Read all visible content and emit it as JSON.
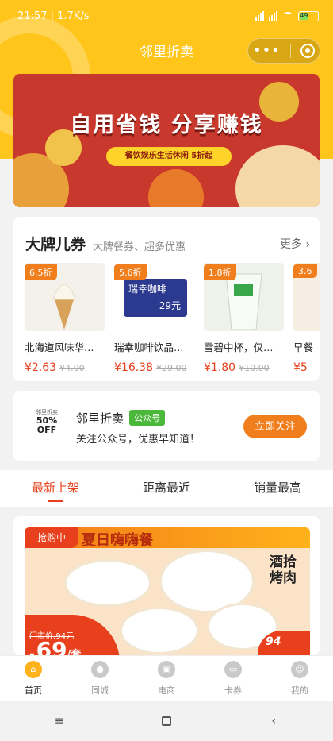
{
  "status_bar": {
    "time": "21:57",
    "speed": "1.7K/s",
    "battery": "49"
  },
  "header": {
    "title": "邻里折卖",
    "capsule_more_icon": "more-dots-icon",
    "capsule_close_icon": "target-circle-icon"
  },
  "banner": {
    "headline": "自用省钱 分享赚钱",
    "pill": "餐饮娱乐生活休闲  5折起"
  },
  "coupons": {
    "title": "大牌儿券",
    "subtitle": "大牌餐券、超多优惠",
    "more": "更多",
    "items": [
      {
        "discount": "6.5折",
        "name": "北海道风味华…",
        "price": "¥2.63",
        "orig": "¥4.00"
      },
      {
        "discount": "5.6折",
        "name": "瑞幸咖啡饮品…",
        "price": "¥16.38",
        "orig": "¥29.00",
        "brand_text": "瑞幸咖啡",
        "brand_value": "29元"
      },
      {
        "discount": "1.8折",
        "name": "雪碧中杯，仅…",
        "price": "¥1.80",
        "orig": "¥10.00"
      },
      {
        "discount": "3.6",
        "name": "早餐",
        "price": "¥5",
        "orig": ""
      }
    ]
  },
  "follow": {
    "logo_top": "邻里折卖",
    "logo_mid": "50%",
    "logo_bot": "OFF",
    "name": "邻里折卖",
    "tag": "公众号",
    "desc": "关注公众号，优惠早知道！",
    "button": "立即关注"
  },
  "tabs": [
    {
      "label": "最新上架",
      "active": true
    },
    {
      "label": "距离最近",
      "active": false
    },
    {
      "label": "销量最高",
      "active": false
    }
  ],
  "deal": {
    "tag": "抢购中",
    "headline": "夏日嗨嗨餐",
    "brand": "酒拾烤肉",
    "orig_price": "门市价:94元",
    "price": ".69",
    "price_unit": "/套",
    "corner": "94"
  },
  "bottom_nav": [
    {
      "label": "首页",
      "icon": "home-icon",
      "active": true
    },
    {
      "label": "同城",
      "icon": "city-icon",
      "active": false
    },
    {
      "label": "电商",
      "icon": "shop-icon",
      "active": false
    },
    {
      "label": "卡券",
      "icon": "card-icon",
      "active": false
    },
    {
      "label": "我的",
      "icon": "profile-icon",
      "active": false
    }
  ],
  "colors": {
    "brand_yellow": "#ffc51a",
    "accent_orange": "#f07e1c",
    "price_red": "#e8401c"
  }
}
